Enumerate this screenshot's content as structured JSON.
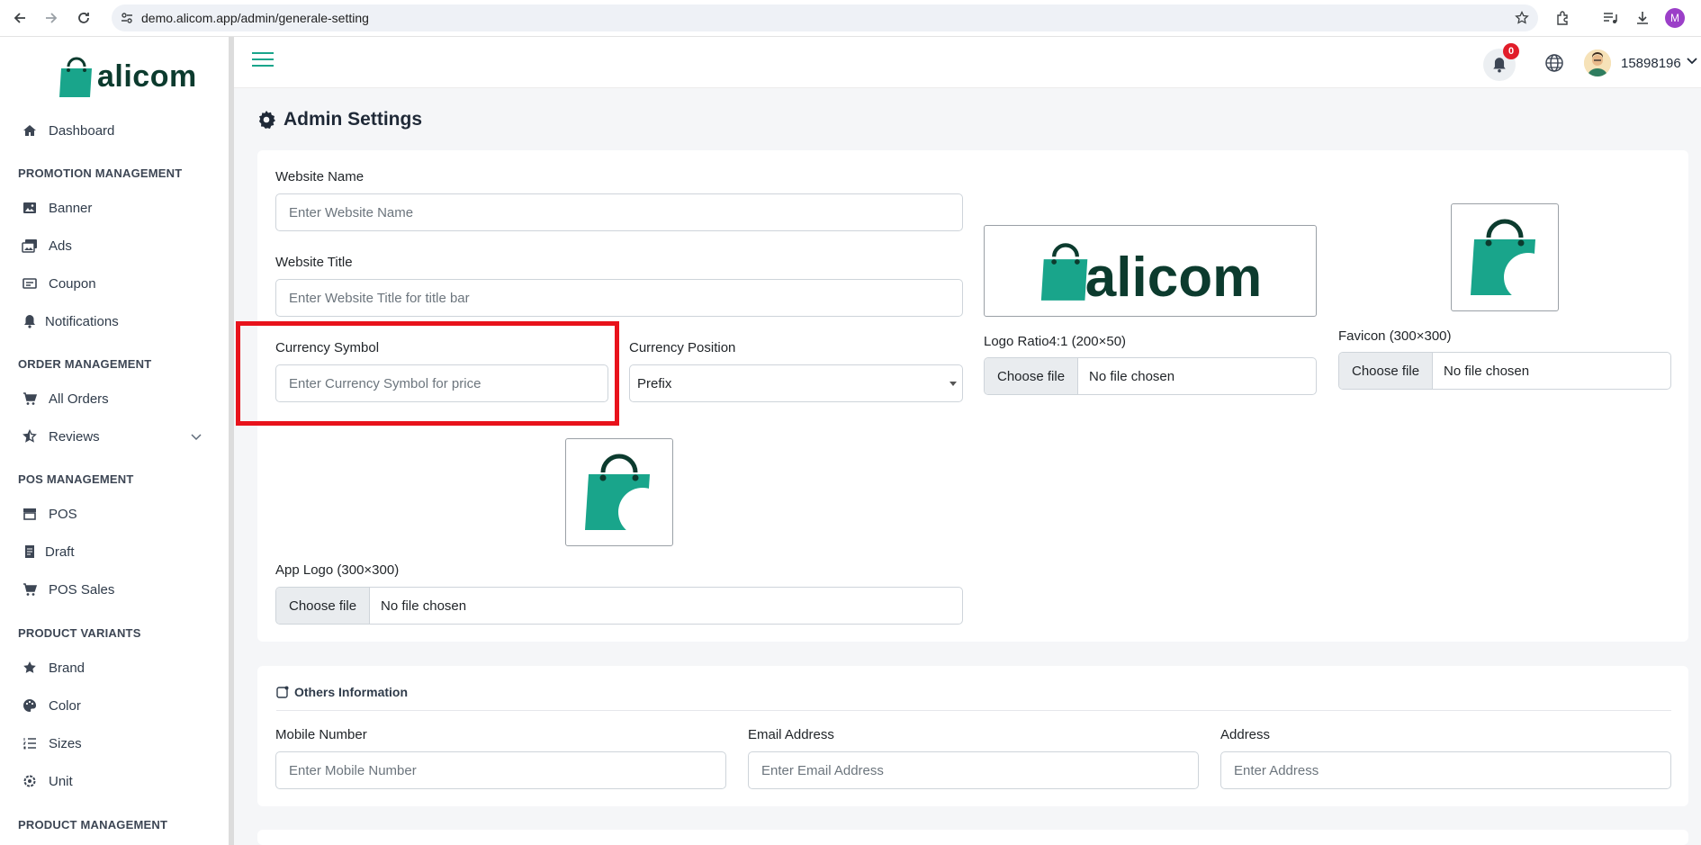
{
  "browser": {
    "url": "demo.alicom.app/admin/generale-setting",
    "profile_initial": "M"
  },
  "sidebar": {
    "logo_text": "alicom",
    "dashboard": "Dashboard",
    "sections": {
      "promotion": "PROMOTION MANAGEMENT",
      "order": "ORDER MANAGEMENT",
      "pos": "POS MANAGEMENT",
      "variants": "PRODUCT VARIANTS",
      "product": "PRODUCT MANAGEMENT"
    },
    "items": {
      "banner": "Banner",
      "ads": "Ads",
      "coupon": "Coupon",
      "notifications": "Notifications",
      "all_orders": "All Orders",
      "reviews": "Reviews",
      "pos": "POS",
      "draft": "Draft",
      "pos_sales": "POS Sales",
      "brand": "Brand",
      "color": "Color",
      "sizes": "Sizes",
      "unit": "Unit"
    }
  },
  "header": {
    "notification_count": "0",
    "user_id": "15898196"
  },
  "main": {
    "page_title": "Admin Settings",
    "general": {
      "website_name_label": "Website Name",
      "website_name_placeholder": "Enter Website Name",
      "website_title_label": "Website Title",
      "website_title_placeholder": "Enter Website Title for title bar",
      "currency_symbol_label": "Currency Symbol",
      "currency_symbol_placeholder": "Enter Currency Symbol for price",
      "currency_position_label": "Currency Position",
      "currency_position_value": "Prefix",
      "logo_preview_text": "alicom",
      "logo_label": "Logo Ratio4:1 (200×50)",
      "favicon_label": "Favicon (300×300)",
      "app_logo_label": "App Logo (300×300)",
      "choose_file": "Choose file",
      "no_file": "No file chosen"
    },
    "others": {
      "title": "Others Information",
      "mobile_label": "Mobile Number",
      "mobile_placeholder": "Enter Mobile Number",
      "email_label": "Email Address",
      "email_placeholder": "Enter Email Address",
      "address_label": "Address",
      "address_placeholder": "Enter Address"
    }
  },
  "colors": {
    "brand_teal": "#19a58b",
    "logo_dark": "#0c3b2e",
    "highlight_red": "#e8121b",
    "badge_red": "#e11d2a"
  }
}
